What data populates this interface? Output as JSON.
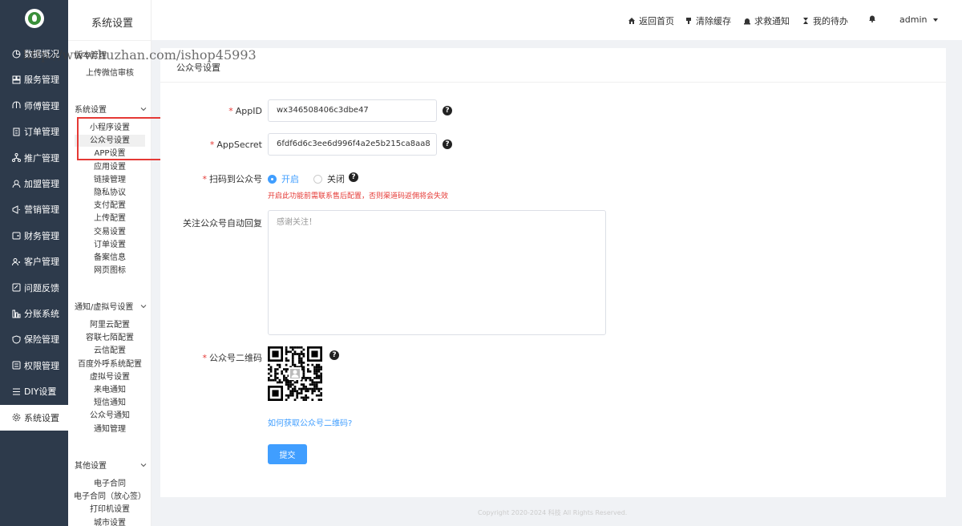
{
  "nav": {
    "items": [
      {
        "label": "数据概况",
        "icon": "chart-icon"
      },
      {
        "label": "服务管理",
        "icon": "grid-icon"
      },
      {
        "label": "师傅管理",
        "icon": "worker-icon"
      },
      {
        "label": "订单管理",
        "icon": "order-icon"
      },
      {
        "label": "推广管理",
        "icon": "share-icon"
      },
      {
        "label": "加盟管理",
        "icon": "user-icon"
      },
      {
        "label": "营销管理",
        "icon": "marketing-icon"
      },
      {
        "label": "财务管理",
        "icon": "wallet-icon"
      },
      {
        "label": "客户管理",
        "icon": "users-icon"
      },
      {
        "label": "问题反馈",
        "icon": "feedback-icon"
      },
      {
        "label": "分账系统",
        "icon": "split-icon"
      },
      {
        "label": "保险管理",
        "icon": "shield-icon"
      },
      {
        "label": "权限管理",
        "icon": "lock-icon"
      },
      {
        "label": "DIY设置",
        "icon": "diy-icon"
      },
      {
        "label": "系统设置",
        "icon": "gear-icon"
      }
    ]
  },
  "submenu": {
    "title": "系统设置",
    "version_head": "版本管理",
    "version_items": [
      "上传微信审核"
    ],
    "system_head": "系统设置",
    "system_items": [
      "小程序设置",
      "公众号设置",
      "APP设置",
      "应用设置",
      "链接管理",
      "隐私协议",
      "支付配置",
      "上传配置",
      "交易设置",
      "订单设置",
      "备案信息",
      "网页图标"
    ],
    "notify_head": "通知/虚拟号设置",
    "notify_items": [
      "阿里云配置",
      "容联七陌配置",
      "云信配置",
      "百度外呼系统配置",
      "虚拟号设置",
      "来电通知",
      "短信通知",
      "公众号通知",
      "通知管理"
    ],
    "other_head": "其他设置",
    "other_items": [
      "电子合同",
      "电子合同（放心签）",
      "打印机设置",
      "城市设置"
    ]
  },
  "header": {
    "home": "返回首页",
    "clear_cache": "清除缓存",
    "rescue": "求救通知",
    "todo": "我的待办",
    "user": "admin"
  },
  "watermark": "http://www.huzhan.com/ishop45993",
  "form": {
    "title": "公众号设置",
    "appid_label": "AppID",
    "appid_value": "wx346508406c3dbe47",
    "secret_label": "AppSecret",
    "secret_value": "6fdf6d6c3ee6d996f4a2e5b215ca8aa8",
    "scan_label": "扫码到公众号",
    "scan_on": "开启",
    "scan_off": "关闭",
    "scan_hint": "开启此功能前需联系售后配置，否则渠道码返佣将会失效",
    "reply_label": "关注公众号自动回复",
    "reply_value": "感谢关注！",
    "qr_label": "公众号二维码",
    "qr_link": "如何获取公众号二维码?",
    "submit": "提交"
  },
  "footer": "Copyright 2020-2024 科技 All Rights Reserved.",
  "colors": {
    "primary": "#409eff",
    "nav_bg": "#2d3a4b",
    "required": "#e53935"
  }
}
